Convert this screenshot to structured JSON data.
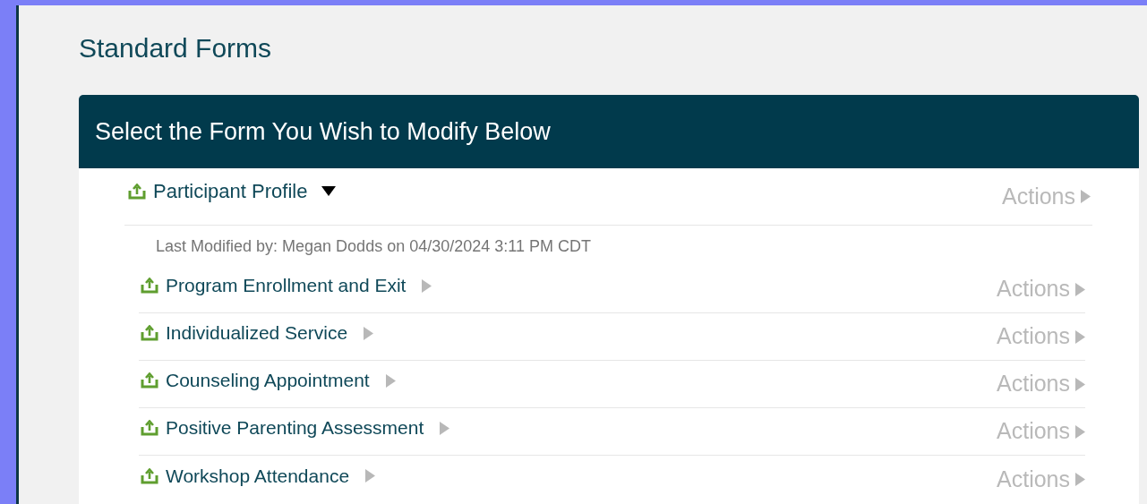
{
  "page_title": "Standard Forms",
  "panel": {
    "title": "Select the Form You Wish to Modify Below",
    "forms": [
      {
        "name": "Participant Profile",
        "expanded": true,
        "actions": "Actions",
        "last_modified": "Last Modified by: Megan Dodds on 04/30/2024 3:11 PM CDT",
        "children": [
          {
            "name": "Program Enrollment and Exit",
            "expanded": false,
            "actions": "Actions"
          },
          {
            "name": "Individualized Service",
            "expanded": false,
            "actions": "Actions"
          },
          {
            "name": "Counseling Appointment",
            "expanded": false,
            "actions": "Actions"
          },
          {
            "name": "Positive Parenting Assessment",
            "expanded": false,
            "actions": "Actions"
          },
          {
            "name": "Workshop Attendance",
            "expanded": false,
            "actions": "Actions"
          }
        ]
      }
    ]
  }
}
